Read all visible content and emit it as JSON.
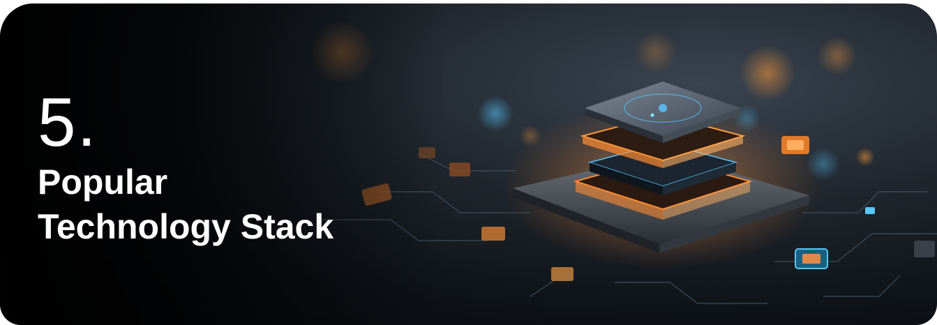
{
  "banner": {
    "number": "5.",
    "title_line1": "Popular",
    "title_line2": "Technology Stack",
    "image_icon": "chip-stack-illustration"
  },
  "colors": {
    "text": "#ffffff",
    "background_dark": "#0d1116",
    "glow_orange": "#ff9a3c",
    "glow_blue": "#58c8ff"
  }
}
